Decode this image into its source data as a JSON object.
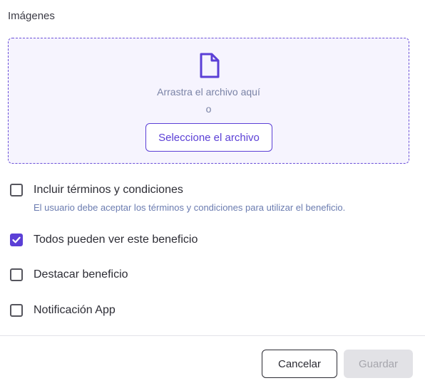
{
  "images": {
    "label": "Imágenes",
    "drop_text": "Arrastra el archivo aquí",
    "or_text": "o",
    "select_button": "Seleccione el archivo"
  },
  "options": [
    {
      "label": "Incluir términos y condiciones",
      "checked": false,
      "help": "El usuario debe aceptar los términos y condiciones para utilizar el beneficio."
    },
    {
      "label": "Todos pueden ver este beneficio",
      "checked": true
    },
    {
      "label": "Destacar beneficio",
      "checked": false
    },
    {
      "label": "Notificación App",
      "checked": false
    }
  ],
  "footer": {
    "cancel_label": "Cancelar",
    "save_label": "Guardar",
    "save_enabled": false
  },
  "colors": {
    "accent": "#5b3fd6",
    "dropzone_bg": "#f6f4fe",
    "help_text": "#6b7cb0",
    "disabled_bg": "#e2e2e6"
  },
  "icons": {
    "dropzone": "file-icon",
    "checked": "check-icon"
  }
}
